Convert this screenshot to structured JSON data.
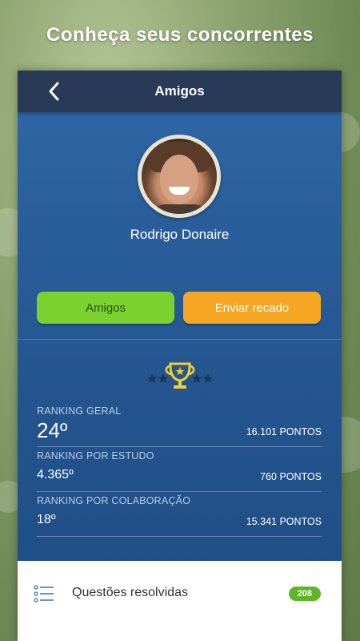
{
  "promo": {
    "title": "Conheça seus concorrentes"
  },
  "topbar": {
    "title": "Amigos"
  },
  "profile": {
    "name": "Rodrigo Donaire"
  },
  "actions": {
    "friends_label": "Amigos",
    "message_label": "Enviar recado"
  },
  "ranking": [
    {
      "label": "RANKING GERAL",
      "value": "24º",
      "points": "16.101 PONTOS"
    },
    {
      "label": "RANKING POR ESTUDO",
      "value": "4.365º",
      "points": "760 PONTOS"
    },
    {
      "label": "RANKING POR COLABORAÇÃO",
      "value": "18º",
      "points": "15.341 PONTOS"
    }
  ],
  "bottom": {
    "label": "Questões resolvidas",
    "count": "208"
  },
  "icons": {
    "back": "chevron-left-icon",
    "trophy": "trophy-icon",
    "list": "list-icon"
  },
  "colors": {
    "card_blue": "#2a5d99",
    "topbar": "#283a55",
    "friends_button": "#7bd12e",
    "message_button": "#f5a623",
    "trophy": "#f2d12b",
    "badge": "#5fb528"
  }
}
